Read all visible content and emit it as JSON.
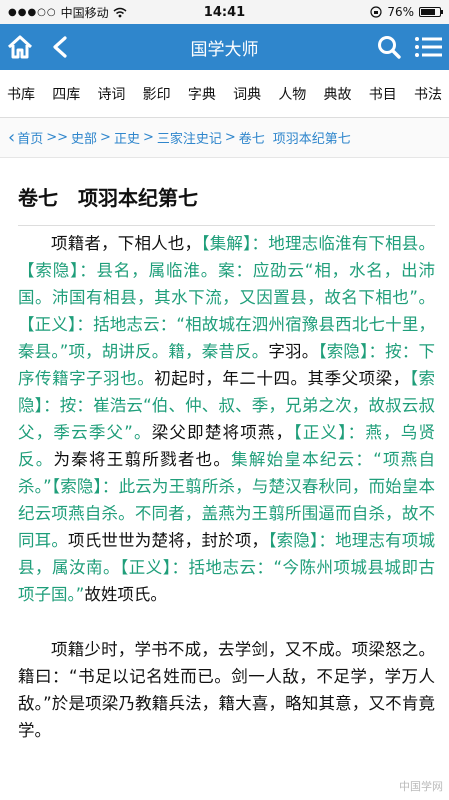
{
  "status": {
    "carrier": "中国移动",
    "time": "14:41",
    "battery": "76%",
    "battery_level": 0.76
  },
  "header": {
    "title": "国学大师",
    "icons": [
      "home-icon",
      "back-icon",
      "search-icon",
      "menu-icon"
    ]
  },
  "categories": [
    "书库",
    "四库",
    "诗词",
    "影印",
    "字典",
    "词典",
    "人物",
    "典故",
    "书目",
    "书法"
  ],
  "breadcrumb": {
    "items": [
      "首页",
      "史部",
      "正史",
      "三家注史记",
      "卷七"
    ],
    "current": "项羽本纪第七"
  },
  "chapter_title": "卷七　项羽本纪第七",
  "paragraphs": [
    [
      {
        "t": "项籍者，下相人也，",
        "s": "k"
      },
      {
        "t": "【集解】：地理志临淮有下相县。【索隐】：县名，属临淮。案：应劭云“相，水名，出沛国。沛国有相县，其水下流，又因置县，故名下相也”。【正义】：括地志云：“相故城在泗州宿豫县西北七十里，秦县。”项，胡讲反。籍，秦昔反。",
        "s": "g"
      },
      {
        "t": "字羽。",
        "s": "k"
      },
      {
        "t": "【索隐】：按：下序传籍字子羽也。",
        "s": "g"
      },
      {
        "t": "初起时，年二十四。其季父项梁，",
        "s": "k"
      },
      {
        "t": "【索隐】：按：崔浩云“伯、仲、叔、季，兄弟之次，故叔云叔父，季云季父”。",
        "s": "g"
      },
      {
        "t": "梁父即楚将项燕，",
        "s": "k"
      },
      {
        "t": "【正义】：燕，乌贤反。",
        "s": "g"
      },
      {
        "t": "为秦将王翦所戮者也。",
        "s": "k"
      },
      {
        "t": "集解始皇本纪云：“项燕自杀。”【索隐】：此云为王翦所杀，与楚汉春秋同，而始皇本纪云项燕自杀。不同者，盖燕为王翦所围逼而自杀，故不同耳。",
        "s": "g"
      },
      {
        "t": "项氏世世为楚将，封於项，",
        "s": "k"
      },
      {
        "t": "【索隐】：地理志有项城县，属汝南。【正义】：括地志云：“今陈州项城县城即古项子国。”",
        "s": "g"
      },
      {
        "t": "故姓项氏。",
        "s": "k"
      }
    ],
    [
      {
        "t": "项籍少时，学书不成，去学剑，又不成。项梁怒之。籍曰：“书足以记名姓而已。剑一人敌，不足学，学万人敌。”於是项梁乃教籍兵法，籍大喜，略知其意，又不肯竟学。",
        "s": "k"
      }
    ]
  ],
  "watermark": "中国学网",
  "colors": {
    "accent": "#2f86cc",
    "commentary": "#1f9e7a"
  }
}
